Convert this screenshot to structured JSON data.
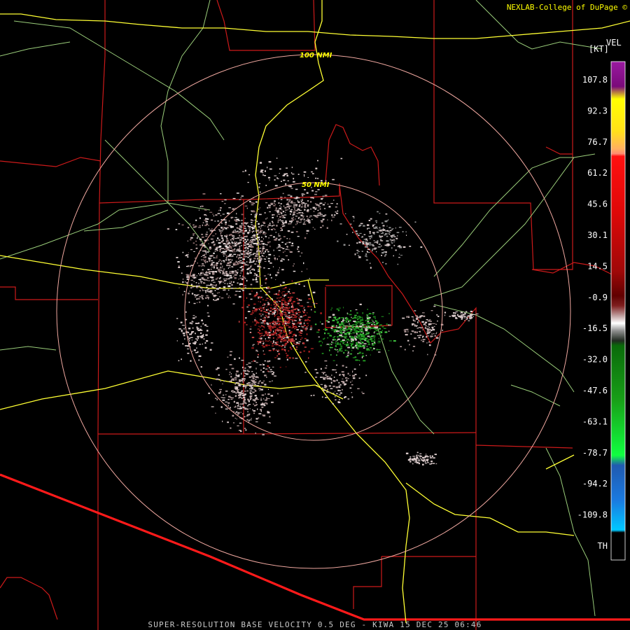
{
  "credit": "NEXLAB-College of DuPage ©",
  "footer": "SUPER-RESOLUTION BASE VELOCITY 0.5 DEG - KIWA 15 DEC 25 06:46",
  "rings": [
    {
      "label": "100 NMI"
    },
    {
      "label": "50 NMI"
    }
  ],
  "legend": {
    "product": "VEL",
    "unit": "[KT]",
    "ticks": [
      "107.8",
      "92.3",
      "76.7",
      "61.2",
      "45.6",
      "30.1",
      "14.5",
      "-0.9",
      "-16.5",
      "-32.0",
      "-47.6",
      "-63.1",
      "-78.7",
      "-94.2",
      "-109.8",
      "TH"
    ]
  },
  "colors": {
    "background": "#000000",
    "county_lines": "#cc1a1a",
    "border_line": "#ff1a1a",
    "highways_major": "#ffff33",
    "highways_minor": "#9acd7a",
    "range_rings": "#f0a8a0",
    "inbound_velocity": "#22a022",
    "outbound_velocity": "#b02020",
    "near_zero_velocity": "#d8c8c8"
  }
}
